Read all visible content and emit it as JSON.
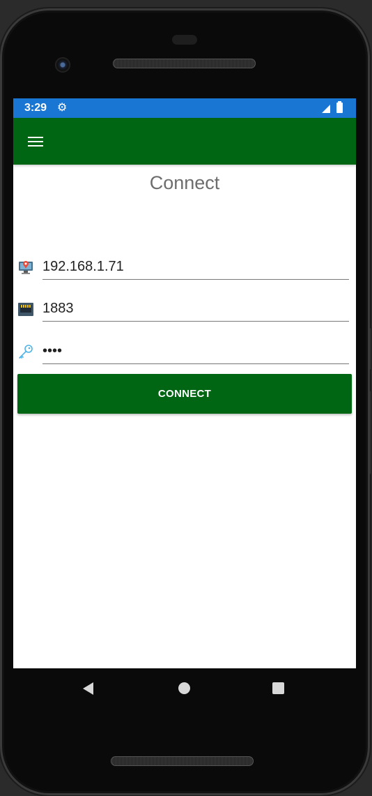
{
  "status_bar": {
    "time": "3:29",
    "settings_icon": "gear-icon",
    "signal_icon": "signal-icon",
    "battery_icon": "battery-icon",
    "color": "#1976d2"
  },
  "app_bar": {
    "menu_icon": "hamburger-menu-icon",
    "color": "#006614"
  },
  "page": {
    "title": "Connect"
  },
  "form": {
    "host": {
      "icon": "network-computer-icon",
      "value": "192.168.1.71"
    },
    "port": {
      "icon": "ethernet-port-icon",
      "value": "1883"
    },
    "password": {
      "icon": "key-icon",
      "value": "••••"
    },
    "connect_label": "CONNECT"
  },
  "nav_bar": {
    "back_icon": "back-triangle-icon",
    "home_icon": "home-circle-icon",
    "recents_icon": "recents-square-icon"
  }
}
